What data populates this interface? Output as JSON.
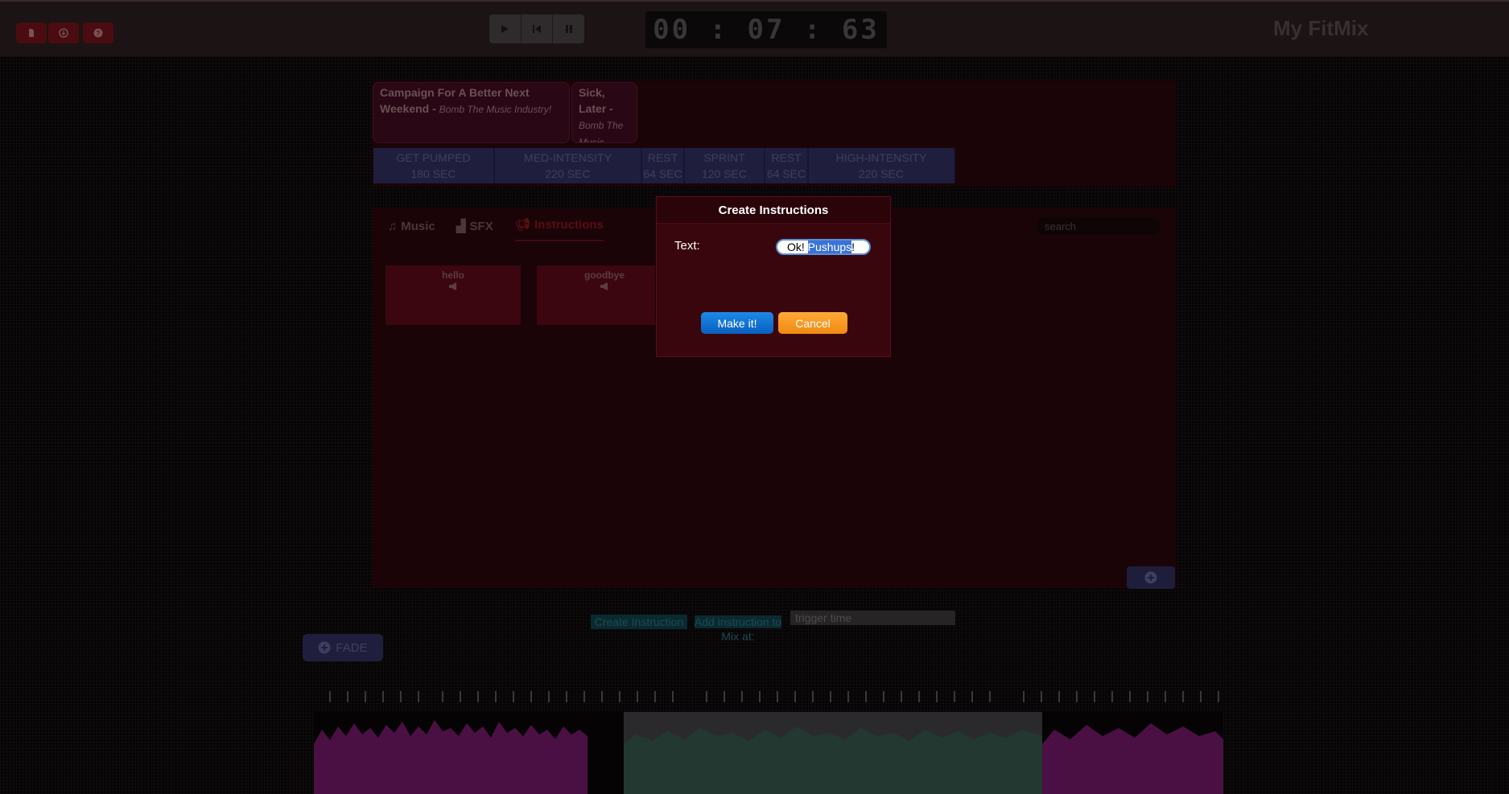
{
  "toolbar": {
    "buttons": [
      {
        "icon": "file-icon"
      },
      {
        "icon": "download-icon"
      },
      {
        "icon": "help-icon"
      }
    ]
  },
  "transport": {
    "play_icon": "play-icon",
    "rewind_icon": "skip-back-icon",
    "pause_icon": "pause-icon"
  },
  "timer": "00:07:63",
  "brand": "My FitMix",
  "songs": [
    {
      "title": "Campaign For A Better Next Weekend - ",
      "artist": "Bomb The Music Industry!"
    },
    {
      "title": "Sick, Later - ",
      "artist": "Bomb The Music"
    }
  ],
  "segments": [
    {
      "name": "GET PUMPED",
      "duration": "180 SEC"
    },
    {
      "name": "MED-INTENSITY",
      "duration": "220 SEC"
    },
    {
      "name": "REST",
      "duration": "64 SEC"
    },
    {
      "name": "SPRINT",
      "duration": "120 SEC"
    },
    {
      "name": "REST",
      "duration": "64 SEC"
    },
    {
      "name": "HIGH-INTENSITY",
      "duration": "220 SEC"
    }
  ],
  "library": {
    "tabs": [
      {
        "label": "Music"
      },
      {
        "label": "SFX"
      },
      {
        "label": "Instructions"
      }
    ],
    "search_placeholder": "search",
    "cards": [
      {
        "label": "hello"
      },
      {
        "label": "goodbye"
      }
    ]
  },
  "controls": {
    "create_instruction": "Create Instruction",
    "add_instruction_line1": "Add instruction to",
    "add_instruction_line2": "Mix at:",
    "trigger_placeholder": "trigger time",
    "fade_label": "FADE"
  },
  "modal": {
    "title": "Create Instructions",
    "text_label": "Text:",
    "input_prefix": "Ok! ",
    "input_selected": "Pushups",
    "input_suffix": "!",
    "make_label": "Make it!",
    "cancel_label": "Cancel"
  },
  "colors": {
    "accent_blue": "#0a5fc0",
    "accent_orange": "#f08a10",
    "modal_bg": "#3a060d"
  }
}
